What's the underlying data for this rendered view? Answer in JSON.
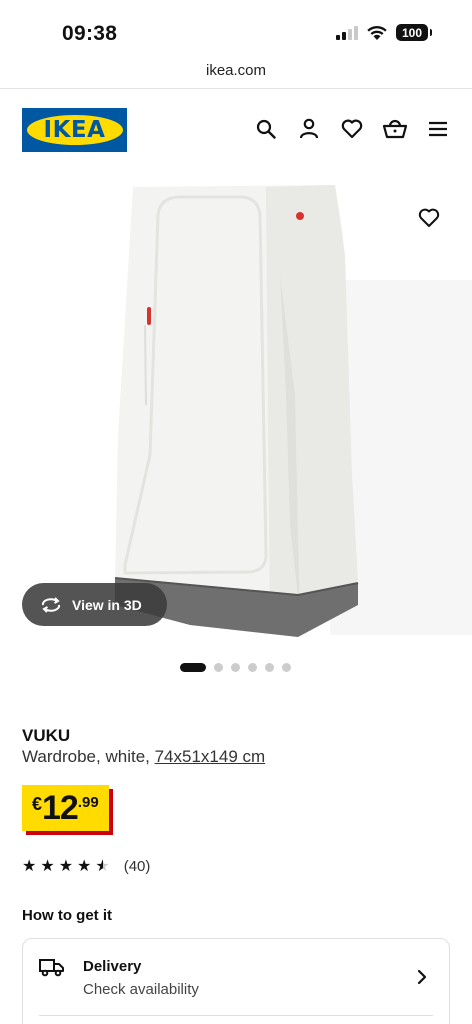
{
  "status_bar": {
    "time": "09:38",
    "battery": "100"
  },
  "browser": {
    "url": "ikea.com"
  },
  "header": {
    "logo_text": "IKEA",
    "icons": [
      "search-icon",
      "account-icon",
      "heart-icon",
      "basket-icon",
      "menu-icon"
    ]
  },
  "gallery": {
    "view3d_label": "View in 3D",
    "image_count": 6,
    "active_index": 0
  },
  "product": {
    "name": "VUKU",
    "description": "Wardrobe, white, ",
    "dimensions": "74x51x149 cm",
    "price": {
      "currency": "€",
      "integer": "12",
      "decimal": ".99"
    },
    "rating": {
      "value": 4.5,
      "max": 5,
      "count": "(40)"
    }
  },
  "get_it": {
    "heading": "How to get it",
    "delivery": {
      "title": "Delivery",
      "subtitle": "Check availability"
    }
  },
  "colors": {
    "ikea_blue": "#0058a3",
    "ikea_yellow": "#ffdb00",
    "price_red": "#cc0008"
  }
}
